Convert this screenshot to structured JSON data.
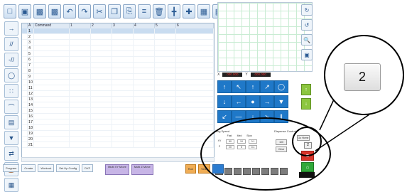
{
  "toolbar": {
    "icons": [
      "new-file-icon",
      "open-folder-icon",
      "save-icon",
      "save-as-icon",
      "undo-icon",
      "redo-icon",
      "cut-icon",
      "copy-icon",
      "paste-icon",
      "insert-icon",
      "delete-icon",
      "point-icon",
      "crosshair-icon",
      "table-icon",
      "save-point-icon"
    ]
  },
  "grid": {
    "headers": [
      "A",
      "Command",
      "1",
      "2",
      "3",
      "4",
      "5",
      "6"
    ],
    "rows": [
      "1",
      "2",
      "3",
      "4",
      "5",
      "6",
      "7",
      "8",
      "9",
      "10",
      "11",
      "12",
      "13",
      "14",
      "15",
      "16",
      "17",
      "18",
      "19",
      "20",
      "21"
    ],
    "selected_row": "1"
  },
  "coords": {
    "x_label": "X",
    "y_label": "Y",
    "x_value": "000.000",
    "y_value": "000.000"
  },
  "jog": {
    "title": "Jog Speed",
    "col_fast": "Fast",
    "col_med": "Med",
    "col_slow": "Slow",
    "row_xy": "XY",
    "row_z": "Z",
    "xy_fast": "50",
    "xy_med": "10",
    "xy_slow": "0.1",
    "z_fast": "20",
    "z_med": "5",
    "z_slow": "0.1",
    "servo_title": "Dispense Control",
    "servo_value": "100",
    "servo_btn": "Clear",
    "go_home": "Go Home"
  },
  "bottombar": {
    "program": "Program",
    "create": "Create",
    "workout": "Workout",
    "set_up": "Set Up Config",
    "dxf": "DXF",
    "multi_1": "Multi XY Move",
    "multi_2": "Multi Z Move",
    "run": "Run",
    "view": "View"
  },
  "callout": {
    "label": "2",
    "small_label": "2"
  },
  "colors": {
    "accent_blue": "#1f78c8",
    "run_orange": "#f0ad55",
    "stop_red": "#d9362b",
    "home_green": "#31a83a"
  }
}
